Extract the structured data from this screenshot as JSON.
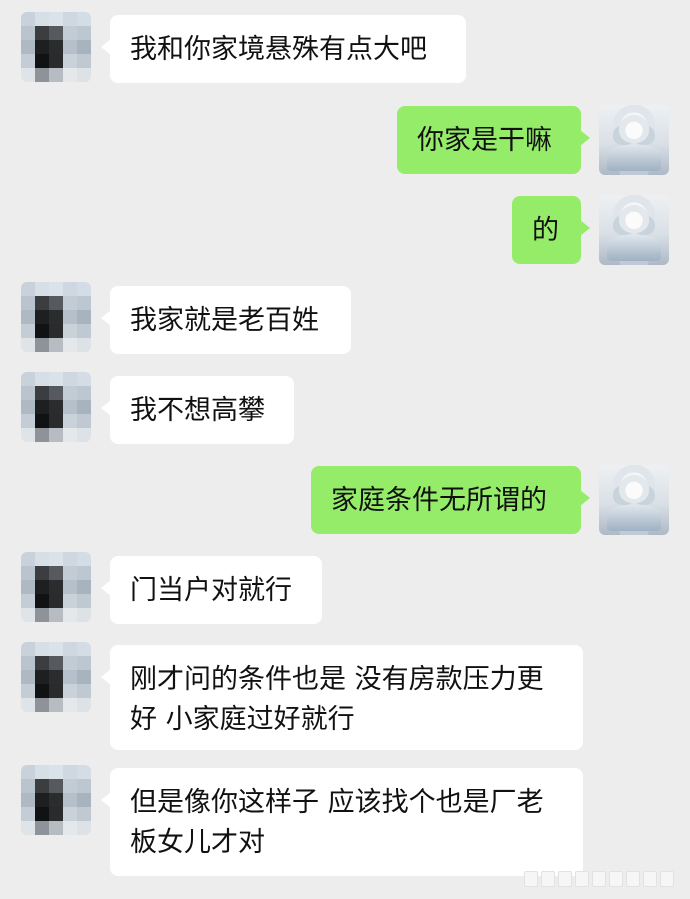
{
  "colors": {
    "background": "#ededed",
    "incoming_bubble": "#ffffff",
    "outgoing_bubble": "#95ec69",
    "text": "#111111"
  },
  "messages": [
    {
      "side": "left",
      "text": "我和你家境悬殊有点大吧"
    },
    {
      "side": "right",
      "text": "你家是干嘛"
    },
    {
      "side": "right",
      "text": "的"
    },
    {
      "side": "left",
      "text": "我家就是老百姓"
    },
    {
      "side": "left",
      "text": "我不想高攀"
    },
    {
      "side": "right",
      "text": "家庭条件无所谓的"
    },
    {
      "side": "left",
      "text": "门当户对就行"
    },
    {
      "side": "left",
      "text": "刚才问的条件也是 没有房款压力更好 小家庭过好就行"
    },
    {
      "side": "left",
      "text": "但是像你这样子 应该找个也是厂老板女儿才对"
    }
  ],
  "avatars": {
    "other": "pixelated-photo-avatar",
    "self": "anime-character-avatar"
  }
}
